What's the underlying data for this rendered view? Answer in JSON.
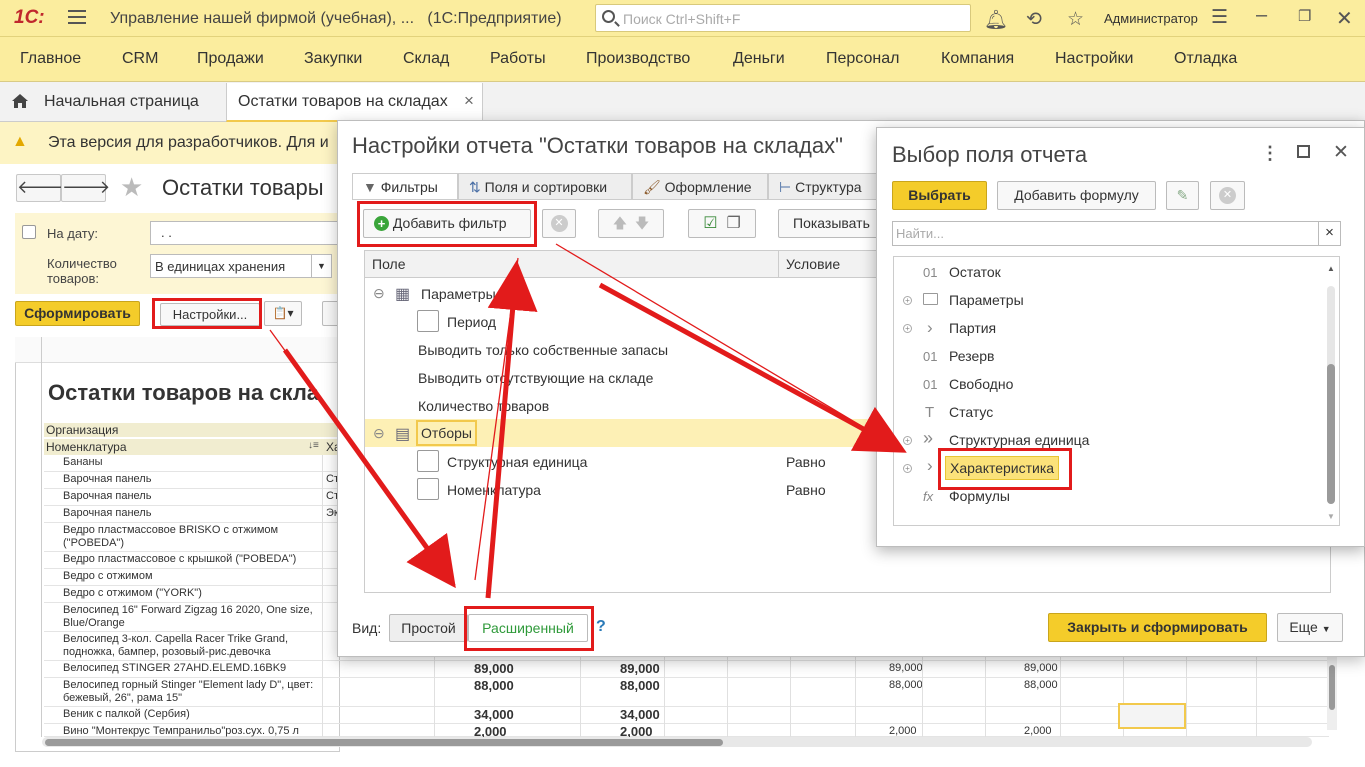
{
  "app": {
    "logo": "1С:",
    "title": "Управление нашей фирмой (учебная), ...",
    "platform": "(1С:Предприятие)",
    "search_placeholder": "Поиск Ctrl+Shift+F",
    "user": "Администратор"
  },
  "menu": [
    "Главное",
    "CRM",
    "Продажи",
    "Закупки",
    "Склад",
    "Работы",
    "Производство",
    "Деньги",
    "Персонал",
    "Компания",
    "Настройки",
    "Отладка"
  ],
  "tabs": {
    "home": "Начальная страница",
    "active": "Остатки товаров на складах",
    "close": "×"
  },
  "notice": "Эта версия для разработчиков. Для и",
  "page": {
    "title": "Остатки товары",
    "back": "🡐",
    "forward": "🡒"
  },
  "form": {
    "date_label": "На дату:",
    "date_value": ". .",
    "qty_label": "Количество товаров:",
    "qty_value": "В единицах хранения",
    "build_btn": "Сформировать",
    "settings_btn": "Настройки..."
  },
  "report": {
    "title": "Остатки товаров на скла",
    "hdr_org": "Организация",
    "hdr_nom": "Номенклатура",
    "hdr_char": "Ха",
    "rows": [
      {
        "name": "Бананы",
        "c2": "",
        "v1": "",
        "v2": "",
        "v3": "",
        "v4": ""
      },
      {
        "name": "Варочная панель",
        "c2": "Ст",
        "v1": "",
        "v2": "",
        "v3": "",
        "v4": ""
      },
      {
        "name": "Варочная панель",
        "c2": "Ст",
        "v1": "",
        "v2": "",
        "v3": "",
        "v4": ""
      },
      {
        "name": "Варочная панель",
        "c2": "Эк",
        "v1": "",
        "v2": "",
        "v3": "",
        "v4": ""
      },
      {
        "name": "Ведро пластмассовое BRISKO с отжимом (\"POBEDA\")",
        "c2": "",
        "v1": "",
        "v2": "",
        "v3": "",
        "v4": ""
      },
      {
        "name": "Ведро пластмассовое с крышкой (\"POBEDA\")",
        "c2": "",
        "v1": "",
        "v2": "",
        "v3": "",
        "v4": ""
      },
      {
        "name": "Ведро с отжимом",
        "c2": "",
        "v1": "",
        "v2": "",
        "v3": "",
        "v4": ""
      },
      {
        "name": "Ведро с отжимом (\"YORK\")",
        "c2": "",
        "v1": "",
        "v2": "",
        "v3": "",
        "v4": ""
      },
      {
        "name": "Велосипед 16\" Forward Zigzag 16 2020, One size, Blue/Orange",
        "c2": "",
        "v1": "",
        "v2": "",
        "v3": "",
        "v4": ""
      },
      {
        "name": "Велосипед 3-кол. Capella Racer Trike Grand, подножка, бампер, розовый-рис.девочка",
        "c2": "",
        "v1": "",
        "v2": "",
        "v3": "",
        "v4": ""
      },
      {
        "name": "Велосипед STINGER 27AHD.ELEMD.16BK9",
        "c2": "",
        "v1": "89,000",
        "v2": "89,000",
        "v3": "89,000",
        "v4": "89,000"
      },
      {
        "name": "Велосипед горный Stinger \"Element lady D\", цвет: бежевый, 26\", рама 15\"",
        "c2": "",
        "v1": "88,000",
        "v2": "88,000",
        "v3": "88,000",
        "v4": "88,000"
      },
      {
        "name": "Веник с палкой (Сербия)",
        "c2": "",
        "v1": "34,000",
        "v2": "34,000",
        "v3": "",
        "v4": ""
      },
      {
        "name": "Вино \"Монтекрус Темпранильо\"роз.сух. 0,75 л",
        "c2": "",
        "v1": "2,000",
        "v2": "2,000",
        "v3": "2,000",
        "v4": "2,000"
      }
    ]
  },
  "settings_dialog": {
    "title": "Настройки отчета \"Остатки товаров на складах\"",
    "tabs": [
      "Фильтры",
      "Поля и сортировки",
      "Оформление",
      "Структура"
    ],
    "add_filter": "Добавить фильтр",
    "show_btn": "Показывать",
    "col_field": "Поле",
    "col_cond": "Условие",
    "rows": [
      {
        "label": "Параметры",
        "cond": ""
      },
      {
        "label": "Период",
        "cond": ""
      },
      {
        "label": "Выводить только собственные запасы",
        "cond": ""
      },
      {
        "label": "Выводить отсутствующие на складе",
        "cond": ""
      },
      {
        "label": "Количество товаров",
        "cond": ""
      },
      {
        "label": "Отборы",
        "cond": ""
      },
      {
        "label": "Структурная единица",
        "cond": "Равно"
      },
      {
        "label": "Номенклатура",
        "cond": "Равно"
      }
    ],
    "view_label": "Вид:",
    "view_simple": "Простой",
    "view_extended": "Расширенный",
    "help": "?",
    "close_build": "Закрыть и сформировать",
    "more": "Еще"
  },
  "field_dialog": {
    "title": "Выбор поля отчета",
    "select_btn": "Выбрать",
    "add_formula_btn": "Добавить формулу",
    "search_placeholder": "Найти...",
    "clear": "×",
    "items": [
      {
        "prefix": "01",
        "label": "Остаток"
      },
      {
        "prefix": "▢",
        "label": "Параметры"
      },
      {
        "prefix": "›",
        "label": "Партия"
      },
      {
        "prefix": "01",
        "label": "Резерв"
      },
      {
        "prefix": "01",
        "label": "Свободно"
      },
      {
        "prefix": "T",
        "label": "Статус"
      },
      {
        "prefix": "»",
        "label": "Структурная единица"
      },
      {
        "prefix": "›",
        "label": "Характеристика"
      },
      {
        "prefix": "fx",
        "label": "Формулы"
      }
    ]
  },
  "colors": {
    "accent": "#fbed9e",
    "button_yellow": "#f4cc2a",
    "annotation_red": "#e21b1b",
    "highlight": "#fdf0b5"
  }
}
